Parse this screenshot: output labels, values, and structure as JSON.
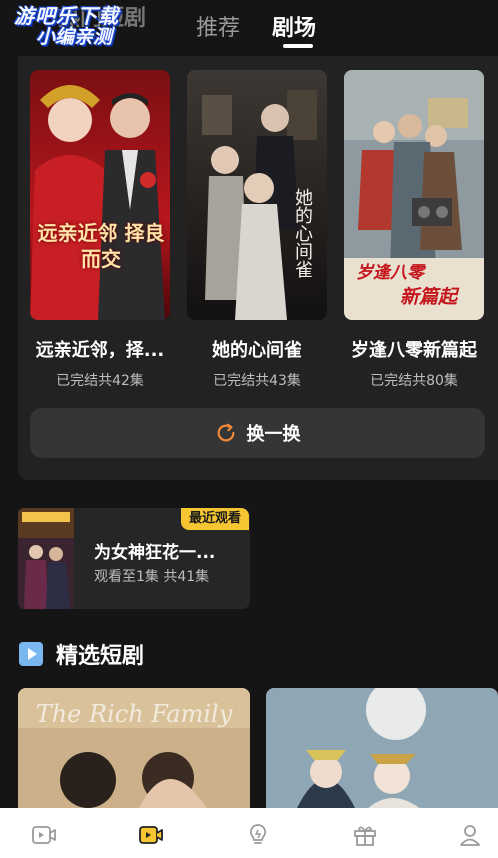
{
  "watermark": {
    "line1": "游吧乐下载",
    "line2": "小编亲测"
  },
  "tabs": [
    {
      "label": "热门短剧"
    },
    {
      "label": "推荐"
    },
    {
      "label": "剧场"
    }
  ],
  "hot": {
    "dramas": [
      {
        "title": "远亲近邻，择...",
        "status": "已完结共42集",
        "poster_text": "远亲近邻 择良而交"
      },
      {
        "title": "她的心间雀",
        "status": "已完结共43集",
        "poster_text": "她的心间雀"
      },
      {
        "title": "岁逢八零新篇起",
        "status": "已完结共80集",
        "poster_text_1": "岁逢八零",
        "poster_text_2": "新篇起"
      }
    ],
    "swap_label": "换一换"
  },
  "recent": {
    "badge": "最近观看",
    "title": "为女神狂花一...",
    "progress": "观看至1集 共41集"
  },
  "featured": {
    "title": "精选短剧",
    "poster1_text": "The Rich Family"
  },
  "colors": {
    "accent": "#f6c632",
    "swap_icon": "#f08a3a",
    "play_icon": "#7ab6f0"
  },
  "nav": [
    {
      "icon": "video-icon"
    },
    {
      "icon": "theater-icon"
    },
    {
      "icon": "bulb-icon"
    },
    {
      "icon": "gift-icon"
    },
    {
      "icon": "user-icon"
    }
  ]
}
